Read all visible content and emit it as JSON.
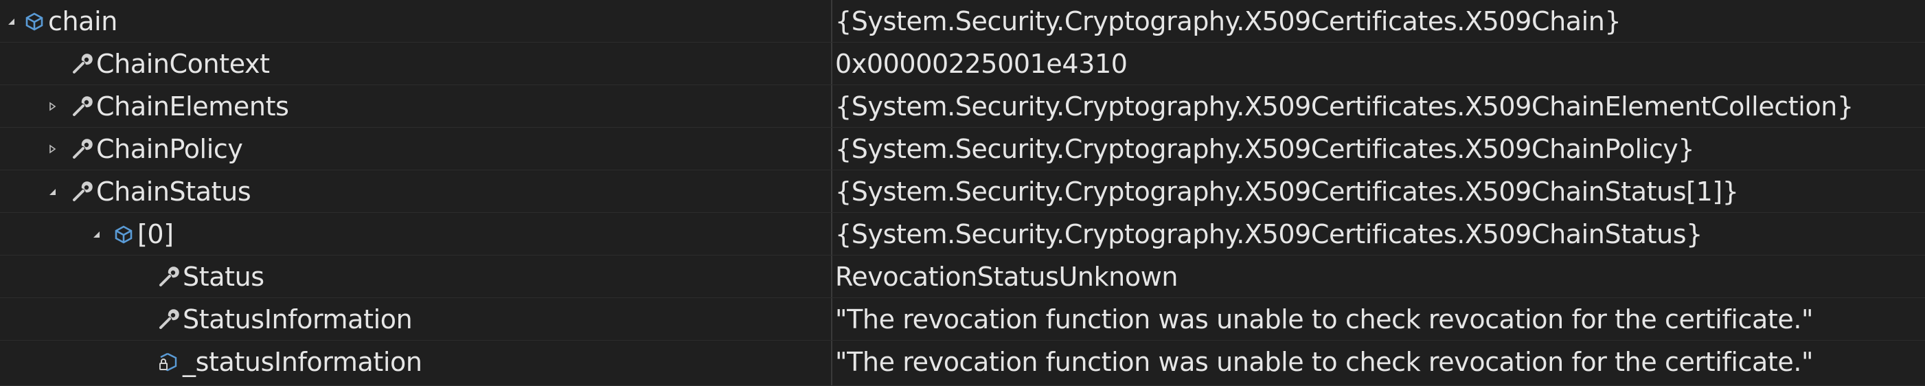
{
  "watch": {
    "rows": [
      {
        "name": "chain",
        "value": "{System.Security.Cryptography.X509Certificates.X509Chain}",
        "expander": "expanded",
        "icon": "object-icon"
      },
      {
        "name": "ChainContext",
        "value": "0x00000225001e4310",
        "expander": "none",
        "icon": "wrench-property-icon"
      },
      {
        "name": "ChainElements",
        "value": "{System.Security.Cryptography.X509Certificates.X509ChainElementCollection}",
        "expander": "collapsed",
        "icon": "wrench-property-icon"
      },
      {
        "name": "ChainPolicy",
        "value": "{System.Security.Cryptography.X509Certificates.X509ChainPolicy}",
        "expander": "collapsed",
        "icon": "wrench-property-icon"
      },
      {
        "name": "ChainStatus",
        "value": "{System.Security.Cryptography.X509Certificates.X509ChainStatus[1]}",
        "expander": "expanded",
        "icon": "wrench-property-icon"
      },
      {
        "name": "[0]",
        "value": "{System.Security.Cryptography.X509Certificates.X509ChainStatus}",
        "expander": "expanded",
        "icon": "object-icon"
      },
      {
        "name": "Status",
        "value": "RevocationStatusUnknown",
        "expander": "none",
        "icon": "wrench-property-icon"
      },
      {
        "name": "StatusInformation",
        "value": "\"The revocation function was unable to check revocation for the certificate.\"",
        "expander": "none",
        "icon": "wrench-property-icon"
      },
      {
        "name": "_statusInformation",
        "value": "\"The revocation function was unable to check revocation for the certificate.\"",
        "expander": "none",
        "icon": "private-field-icon"
      }
    ]
  },
  "colors": {
    "background": "#1f1f1f",
    "text": "#e6e6e6",
    "icon_blue": "#5a9bd6",
    "icon_gray": "#d0d0d0"
  }
}
